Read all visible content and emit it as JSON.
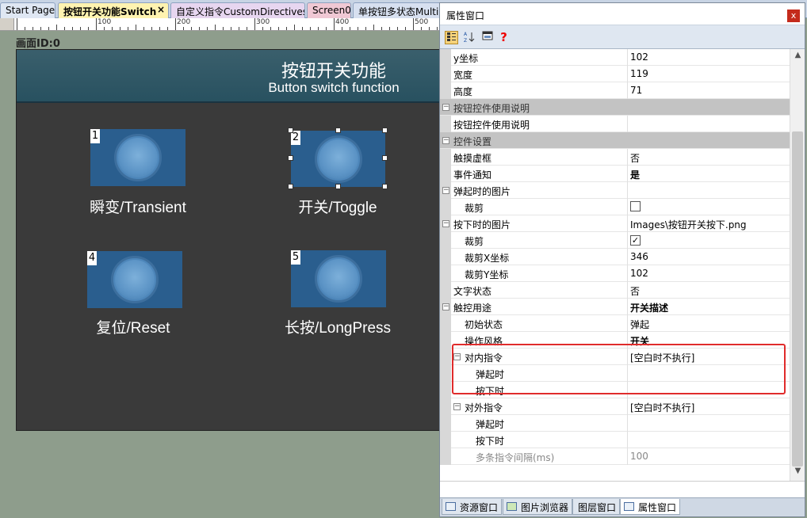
{
  "tabs": [
    {
      "label": "Start Page",
      "active": false
    },
    {
      "label": "按钮开关功能Switch",
      "active": true
    },
    {
      "label": "自定义指令CustomDirectives",
      "active": false
    },
    {
      "label": "Screen0",
      "active": false
    },
    {
      "label": "单按钮多状态Multi",
      "active": false
    }
  ],
  "tab_close": "×",
  "ruler": {
    "labels": [
      "100",
      "200",
      "300",
      "400",
      "500"
    ]
  },
  "screen_id": "画面ID:0",
  "hmi": {
    "title": "按钮开关功能",
    "subtitle": "Button switch function",
    "buttons": [
      {
        "index": "1",
        "label": "瞬变/Transient"
      },
      {
        "index": "2",
        "label": "开关/Toggle"
      },
      {
        "index": "4",
        "label": "复位/Reset"
      },
      {
        "index": "5",
        "label": "长按/LongPress"
      }
    ]
  },
  "prop_window": {
    "title": "属性窗口",
    "close": "x",
    "toolbar": [
      "categorized-icon",
      "sort-az-icon",
      "property-pages-icon",
      "help-icon"
    ],
    "help_glyph": "?",
    "rows": [
      {
        "name": "y坐标",
        "value": "102"
      },
      {
        "name": "宽度",
        "value": "119"
      },
      {
        "name": "高度",
        "value": "71"
      },
      {
        "name": "按钮控件使用说明",
        "category": true
      },
      {
        "name": "按钮控件使用说明",
        "value": ""
      },
      {
        "name": "控件设置",
        "category": true
      },
      {
        "name": "触摸虚框",
        "value": "否"
      },
      {
        "name": "事件通知",
        "value": "是"
      },
      {
        "name": "弹起时的图片",
        "value": "",
        "group": true
      },
      {
        "name": "裁剪",
        "value": "",
        "checkbox": false
      },
      {
        "name": "按下时的图片",
        "value": "Images\\按钮开关按下.png",
        "group": true
      },
      {
        "name": "裁剪",
        "value": "",
        "checkbox": true
      },
      {
        "name": "裁剪X坐标",
        "value": "346"
      },
      {
        "name": "裁剪Y坐标",
        "value": "102"
      },
      {
        "name": "文字状态",
        "value": "否"
      },
      {
        "name": "触控用途",
        "value": "开关描述",
        "group": true,
        "bold": true
      },
      {
        "name": "初始状态",
        "value": "弹起"
      },
      {
        "name": "操作风格",
        "value": "开关",
        "bold": true
      },
      {
        "name": "对内指令",
        "value": "[空白时不执行]",
        "group": true
      },
      {
        "name": "弹起时",
        "value": ""
      },
      {
        "name": "按下时",
        "value": ""
      },
      {
        "name": "对外指令",
        "value": "[空白时不执行]",
        "group": true
      },
      {
        "name": "弹起时",
        "value": ""
      },
      {
        "name": "按下时",
        "value": ""
      },
      {
        "name": "多条指令间隔(ms)",
        "value": "100",
        "dim": true
      }
    ],
    "toggle_glyph": "−",
    "check_glyph": "✓"
  },
  "bottom_tabs": [
    {
      "label": "资源窗口",
      "active": false
    },
    {
      "label": "图片浏览器",
      "active": false
    },
    {
      "label": "图层窗口",
      "active": false
    },
    {
      "label": "属性窗口",
      "active": true
    }
  ],
  "colors": {
    "highlight": "#e02b2b",
    "active_tab": "#fff3b0",
    "tab_bg": "#e7d6f0"
  }
}
